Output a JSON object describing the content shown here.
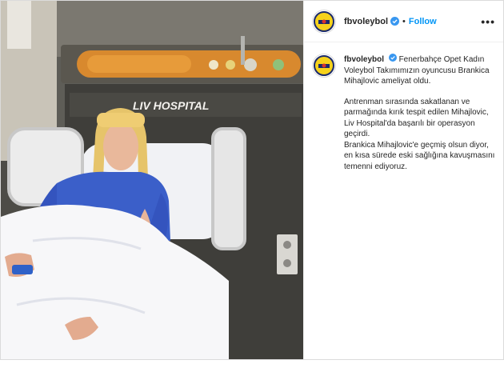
{
  "post": {
    "username": "fbvoleybol",
    "follow_label": "Follow",
    "separator": "•",
    "more_label": "•••",
    "photo_sign": "LIV HOSPITAL",
    "caption_paragraph_1": "Fenerbahçe Opet Kadın Voleybol Takımımızın oyuncusu Brankica Mihajlovic ameliyat oldu.",
    "caption_paragraph_2": "Antrenman sırasında sakatlanan ve parmağında kırık tespit edilen Mihajlovic, Liv Hospital'da başarılı bir operasyon geçirdi.",
    "caption_paragraph_3": "Brankica Mihajlovic'e geçmiş olsun diyor, en kısa sürede eski sağlığına kavuşmasını temenni ediyoruz."
  },
  "colors": {
    "follow": "#0095f6",
    "verified": "#3897f0",
    "logo_yellow": "#f6d21b",
    "logo_navy": "#1b2a6b"
  },
  "icons": {
    "avatar": "fenerbahce-logo-icon",
    "verified": "verified-badge-icon",
    "more": "more-options-icon"
  }
}
